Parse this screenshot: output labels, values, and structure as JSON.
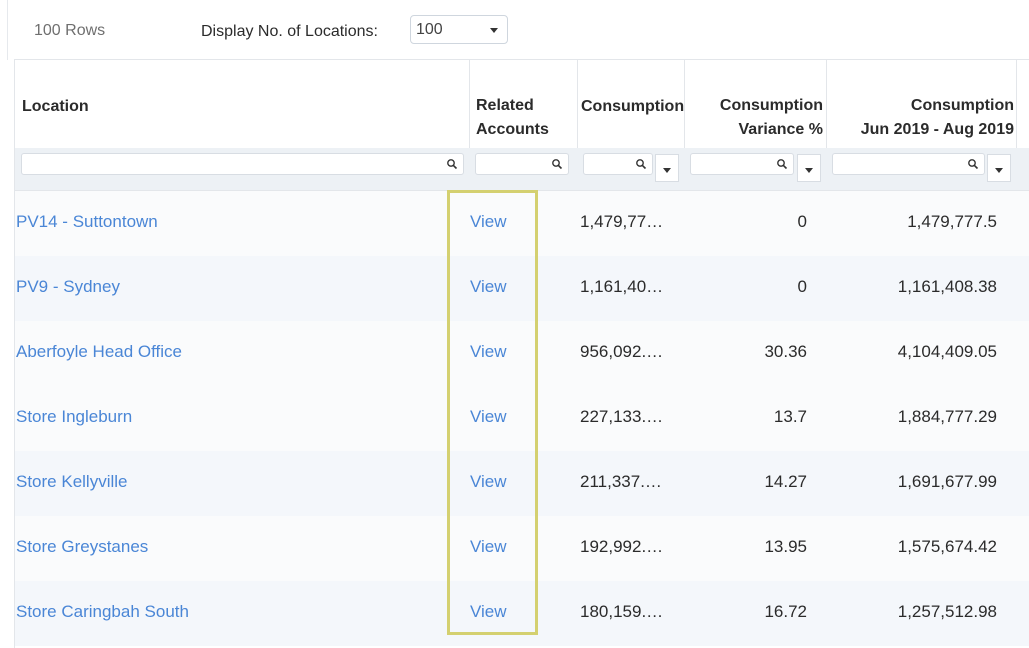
{
  "toolbar": {
    "rows_count": "100 Rows",
    "display_label": "Display No. of Locations:",
    "display_value": "100"
  },
  "columns": [
    {
      "key": "location",
      "line1": "Location",
      "line2": ""
    },
    {
      "key": "related",
      "line1": "Related",
      "line2": "Accounts"
    },
    {
      "key": "consumption",
      "line1": "Consumption",
      "line2": ""
    },
    {
      "key": "variance",
      "line1": "Consumption",
      "line2": "Variance %"
    },
    {
      "key": "period",
      "line1": "Consumption",
      "line2": "Jun 2019 - Aug 2019"
    }
  ],
  "rows": [
    {
      "location": "PV14 - Suttontown",
      "related": "View",
      "consumption": "1,479,77…",
      "variance": "0",
      "period": "1,479,777.5"
    },
    {
      "location": "PV9 - Sydney",
      "related": "View",
      "consumption": "1,161,40…",
      "variance": "0",
      "period": "1,161,408.38"
    },
    {
      "location": "Aberfoyle Head Office",
      "related": "View",
      "consumption": "956,092.…",
      "variance": "30.36",
      "period": "4,104,409.05"
    },
    {
      "location": "Store Ingleburn",
      "related": "View",
      "consumption": "227,133.…",
      "variance": "13.7",
      "period": "1,884,777.29"
    },
    {
      "location": "Store Kellyville",
      "related": "View",
      "consumption": "211,337.…",
      "variance": "14.27",
      "period": "1,691,677.99"
    },
    {
      "location": "Store Greystanes",
      "related": "View",
      "consumption": "192,992.…",
      "variance": "13.95",
      "period": "1,575,674.42"
    },
    {
      "location": "Store Caringbah South",
      "related": "View",
      "consumption": "180,159.…",
      "variance": "16.72",
      "period": "1,257,512.98"
    }
  ],
  "colors": {
    "link": "#4a86d6",
    "highlight": "#d4d070",
    "alt_row": "#f4f7fb"
  }
}
